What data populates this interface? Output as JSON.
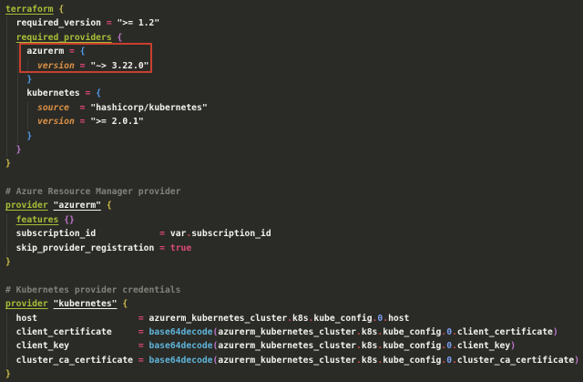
{
  "editor": {
    "background": "#2a2b26",
    "annotation": {
      "label": "highlight box around azurerm provider version",
      "color": "#c8402e",
      "highlighted_text": "azurerm = { version = \"~> 3.22.0\" }"
    },
    "colors": {
      "keyword_green": "#a8bd38",
      "operator_pink": "#e0497a",
      "dot_red": "#d04f55",
      "parameter_orange": "#dd9046",
      "function_cyan": "#5fb3d9",
      "number_blue": "#7a9ff2",
      "bracket_level1_gold": "#cfbd49",
      "bracket_level2_orchid": "#c177cf",
      "bracket_level3_blue": "#4f9df0",
      "comment_gray": "#80817a",
      "text_white": "#f2f2ef"
    },
    "lines": [
      {
        "tokens": [
          [
            "kw",
            "terraform"
          ],
          [
            "plain",
            " "
          ],
          [
            "b1",
            "{"
          ]
        ]
      },
      {
        "tokens": [
          [
            "plain",
            "  "
          ],
          [
            "attr",
            "required_version"
          ],
          [
            "plain",
            " "
          ],
          [
            "op",
            "="
          ],
          [
            "plain",
            " "
          ],
          [
            "str",
            "\">= 1.2\""
          ]
        ]
      },
      {
        "tokens": [
          [
            "plain",
            "  "
          ],
          [
            "kw",
            "required_providers"
          ],
          [
            "plain",
            " "
          ],
          [
            "b2",
            "{"
          ]
        ]
      },
      {
        "tokens": [
          [
            "plain",
            "    "
          ],
          [
            "attr",
            "azurerm"
          ],
          [
            "plain",
            " "
          ],
          [
            "op",
            "="
          ],
          [
            "plain",
            " "
          ],
          [
            "b3",
            "{"
          ]
        ]
      },
      {
        "tokens": [
          [
            "plain",
            "      "
          ],
          [
            "param",
            "version"
          ],
          [
            "plain",
            " "
          ],
          [
            "op",
            "="
          ],
          [
            "plain",
            " "
          ],
          [
            "str",
            "\"~> 3.22.0\""
          ]
        ]
      },
      {
        "tokens": [
          [
            "plain",
            "    "
          ],
          [
            "b3",
            "}"
          ]
        ]
      },
      {
        "tokens": [
          [
            "plain",
            "    "
          ],
          [
            "attr",
            "kubernetes"
          ],
          [
            "plain",
            " "
          ],
          [
            "op",
            "="
          ],
          [
            "plain",
            " "
          ],
          [
            "b3",
            "{"
          ]
        ]
      },
      {
        "tokens": [
          [
            "plain",
            "      "
          ],
          [
            "param",
            "source"
          ],
          [
            "plain",
            "  "
          ],
          [
            "op",
            "="
          ],
          [
            "plain",
            " "
          ],
          [
            "str",
            "\"hashicorp/kubernetes\""
          ]
        ]
      },
      {
        "tokens": [
          [
            "plain",
            "      "
          ],
          [
            "param",
            "version"
          ],
          [
            "plain",
            " "
          ],
          [
            "op",
            "="
          ],
          [
            "plain",
            " "
          ],
          [
            "str",
            "\">= 2.0.1\""
          ]
        ]
      },
      {
        "tokens": [
          [
            "plain",
            "    "
          ],
          [
            "b3",
            "}"
          ]
        ]
      },
      {
        "tokens": [
          [
            "plain",
            "  "
          ],
          [
            "b2",
            "}"
          ]
        ]
      },
      {
        "tokens": [
          [
            "b1",
            "}"
          ]
        ]
      },
      {
        "tokens": []
      },
      {
        "tokens": [
          [
            "com",
            "# Azure Resource Manager provider"
          ]
        ]
      },
      {
        "tokens": [
          [
            "kw",
            "provider"
          ],
          [
            "plain",
            " "
          ],
          [
            "strU",
            "\"azurerm\""
          ],
          [
            "plain",
            " "
          ],
          [
            "b1",
            "{"
          ]
        ]
      },
      {
        "tokens": [
          [
            "plain",
            "  "
          ],
          [
            "kw",
            "features"
          ],
          [
            "plain",
            " "
          ],
          [
            "b2",
            "{}"
          ]
        ]
      },
      {
        "tokens": [
          [
            "plain",
            "  "
          ],
          [
            "attr",
            "subscription_id"
          ],
          [
            "plain",
            "            "
          ],
          [
            "op",
            "="
          ],
          [
            "plain",
            " "
          ],
          [
            "plain",
            "var"
          ],
          [
            "dot",
            "."
          ],
          [
            "plain",
            "subscription_id"
          ]
        ]
      },
      {
        "tokens": [
          [
            "plain",
            "  "
          ],
          [
            "attr",
            "skip_provider_registration"
          ],
          [
            "plain",
            " "
          ],
          [
            "op",
            "="
          ],
          [
            "plain",
            " "
          ],
          [
            "bool",
            "true"
          ]
        ]
      },
      {
        "tokens": [
          [
            "b1",
            "}"
          ]
        ]
      },
      {
        "tokens": []
      },
      {
        "tokens": [
          [
            "com",
            "# Kubernetes provider credentials"
          ]
        ]
      },
      {
        "tokens": [
          [
            "kw",
            "provider"
          ],
          [
            "plain",
            " "
          ],
          [
            "strU",
            "\"kubernetes\""
          ],
          [
            "plain",
            " "
          ],
          [
            "b1",
            "{"
          ]
        ]
      },
      {
        "tokens": [
          [
            "plain",
            "  "
          ],
          [
            "attr",
            "host"
          ],
          [
            "plain",
            "                   "
          ],
          [
            "op",
            "="
          ],
          [
            "plain",
            " "
          ],
          [
            "plain",
            "azurerm_kubernetes_cluster"
          ],
          [
            "dot",
            "."
          ],
          [
            "plain",
            "k8s"
          ],
          [
            "dot",
            "."
          ],
          [
            "plain",
            "kube_config"
          ],
          [
            "dot",
            "."
          ],
          [
            "num",
            "0"
          ],
          [
            "dot",
            "."
          ],
          [
            "plain",
            "host"
          ]
        ]
      },
      {
        "tokens": [
          [
            "plain",
            "  "
          ],
          [
            "attr",
            "client_certificate"
          ],
          [
            "plain",
            "     "
          ],
          [
            "op",
            "="
          ],
          [
            "plain",
            " "
          ],
          [
            "fn",
            "base64decode"
          ],
          [
            "b2",
            "("
          ],
          [
            "plain",
            "azurerm_kubernetes_cluster"
          ],
          [
            "dot",
            "."
          ],
          [
            "plain",
            "k8s"
          ],
          [
            "dot",
            "."
          ],
          [
            "plain",
            "kube_config"
          ],
          [
            "dot",
            "."
          ],
          [
            "num",
            "0"
          ],
          [
            "dot",
            "."
          ],
          [
            "plain",
            "client_certificate"
          ],
          [
            "b2",
            ")"
          ]
        ]
      },
      {
        "tokens": [
          [
            "plain",
            "  "
          ],
          [
            "attr",
            "client_key"
          ],
          [
            "plain",
            "             "
          ],
          [
            "op",
            "="
          ],
          [
            "plain",
            " "
          ],
          [
            "fn",
            "base64decode"
          ],
          [
            "b2",
            "("
          ],
          [
            "plain",
            "azurerm_kubernetes_cluster"
          ],
          [
            "dot",
            "."
          ],
          [
            "plain",
            "k8s"
          ],
          [
            "dot",
            "."
          ],
          [
            "plain",
            "kube_config"
          ],
          [
            "dot",
            "."
          ],
          [
            "num",
            "0"
          ],
          [
            "dot",
            "."
          ],
          [
            "plain",
            "client_key"
          ],
          [
            "b2",
            ")"
          ]
        ]
      },
      {
        "tokens": [
          [
            "plain",
            "  "
          ],
          [
            "attr",
            "cluster_ca_certificate"
          ],
          [
            "plain",
            " "
          ],
          [
            "op",
            "="
          ],
          [
            "plain",
            " "
          ],
          [
            "fn",
            "base64decode"
          ],
          [
            "b2",
            "("
          ],
          [
            "plain",
            "azurerm_kubernetes_cluster"
          ],
          [
            "dot",
            "."
          ],
          [
            "plain",
            "k8s"
          ],
          [
            "dot",
            "."
          ],
          [
            "plain",
            "kube_config"
          ],
          [
            "dot",
            "."
          ],
          [
            "num",
            "0"
          ],
          [
            "dot",
            "."
          ],
          [
            "plain",
            "cluster_ca_certificate"
          ],
          [
            "b2",
            ")"
          ]
        ]
      },
      {
        "tokens": [
          [
            "b1",
            "}"
          ]
        ]
      }
    ]
  }
}
